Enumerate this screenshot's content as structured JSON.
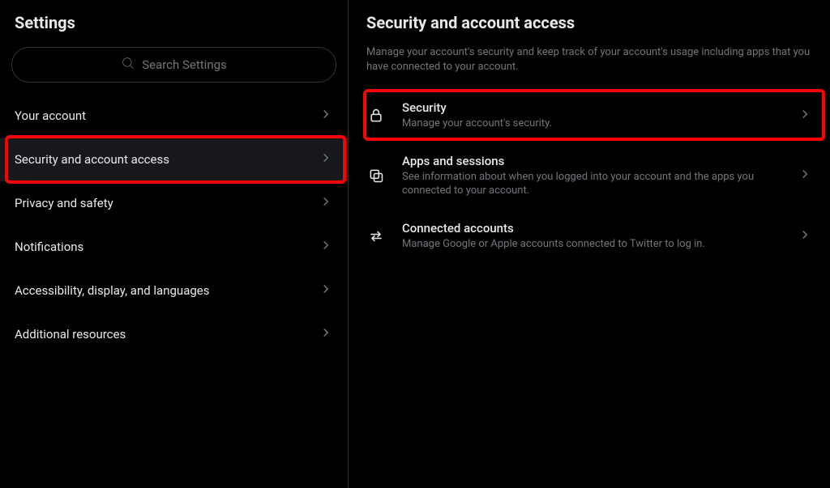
{
  "sidebar": {
    "title": "Settings",
    "search_placeholder": "Search Settings",
    "items": [
      {
        "label": "Your account"
      },
      {
        "label": "Security and account access"
      },
      {
        "label": "Privacy and safety"
      },
      {
        "label": "Notifications"
      },
      {
        "label": "Accessibility, display, and languages"
      },
      {
        "label": "Additional resources"
      }
    ]
  },
  "main": {
    "title": "Security and account access",
    "description": "Manage your account's security and keep track of your account's usage including apps that you have connected to your account.",
    "rows": [
      {
        "title": "Security",
        "sub": "Manage your account's security."
      },
      {
        "title": "Apps and sessions",
        "sub": "See information about when you logged into your account and the apps you connected to your account."
      },
      {
        "title": "Connected accounts",
        "sub": "Manage Google or Apple accounts connected to Twitter to log in."
      }
    ]
  }
}
